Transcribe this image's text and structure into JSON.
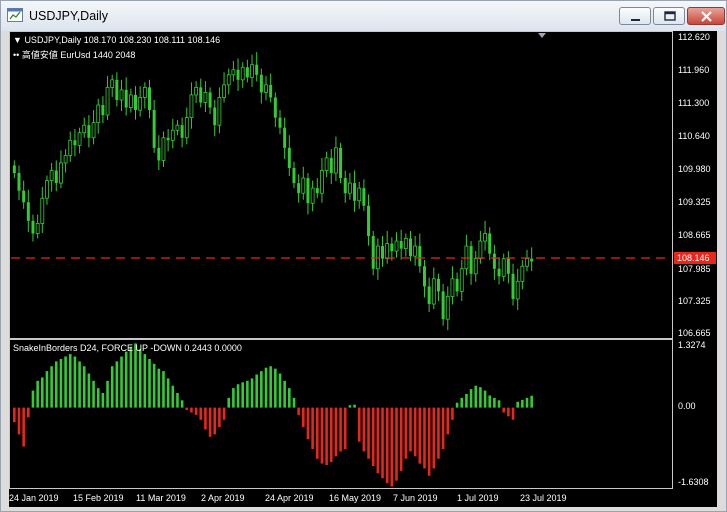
{
  "window": {
    "title": "USDJPY,Daily",
    "buttons": [
      "minimize",
      "maximize",
      "close"
    ]
  },
  "main_chart": {
    "header_line": "USDJPY,Daily  108.170 108.230 108.111 108.146",
    "subheader_line": "高値安値 EurUsd 1440 2048",
    "current_price_label": "108.146",
    "price_axis_labels": [
      "112.620",
      "111.960",
      "111.300",
      "110.640",
      "109.980",
      "109.325",
      "108.665",
      "107.985",
      "107.325",
      "106.665"
    ],
    "colors": {
      "background": "#000000",
      "candles": "#32cd32",
      "price_line": "#e8261c"
    }
  },
  "indicator": {
    "header_line": "SnakeInBorders D24, FORCE UP -DOWN  0.2443 0.0000",
    "axis_labels": [
      "1.3274",
      "0.00",
      "-1.6308"
    ],
    "colors": {
      "positive": "#32cd32",
      "negative": "#e8261c"
    }
  },
  "date_axis": [
    "24 Jan 2019",
    "15 Feb 2019",
    "11 Mar 2019",
    "2 Apr 2019",
    "24 Apr 2019",
    "16 May 2019",
    "7 Jun 2019",
    "1 Jul 2019",
    "23 Jul 2019"
  ],
  "chart_data": {
    "type": "candlestick",
    "symbol": "USDJPY",
    "timeframe": "Daily",
    "last_bar": {
      "open": 108.17,
      "high": 108.23,
      "low": 108.111,
      "close": 108.146
    },
    "y_range": [
      106.665,
      112.62
    ],
    "closes": [
      109.9,
      109.55,
      109.32,
      108.95,
      108.7,
      108.9,
      109.4,
      109.75,
      109.95,
      109.7,
      110.1,
      110.25,
      110.55,
      110.45,
      110.7,
      110.85,
      110.6,
      110.9,
      111.25,
      111.05,
      111.6,
      111.75,
      111.35,
      111.55,
      111.2,
      111.45,
      111.15,
      111.4,
      111.6,
      111.15,
      110.4,
      110.15,
      110.6,
      110.55,
      110.75,
      110.85,
      110.6,
      111.0,
      111.45,
      111.6,
      111.3,
      111.5,
      111.2,
      110.85,
      111.4,
      111.65,
      111.85,
      111.95,
      111.75,
      112.0,
      111.8,
      112.05,
      111.85,
      111.5,
      111.65,
      111.4,
      111.0,
      110.8,
      110.4,
      110.0,
      109.7,
      109.5,
      109.8,
      109.3,
      109.6,
      109.5,
      109.95,
      110.2,
      109.9,
      110.4,
      109.8,
      109.5,
      109.7,
      109.35,
      109.6,
      109.25,
      108.65,
      108.0,
      108.45,
      108.2,
      108.5,
      108.35,
      108.55,
      108.4,
      108.6,
      108.25,
      108.45,
      108.05,
      107.65,
      107.3,
      107.8,
      107.55,
      107.0,
      107.45,
      107.8,
      107.55,
      108.0,
      108.45,
      107.9,
      108.2,
      108.55,
      108.7,
      108.3,
      108.0,
      107.85,
      108.2,
      107.9,
      107.4,
      107.75,
      108.05,
      108.2,
      108.146
    ],
    "indicator": {
      "name": "SnakeInBorders D24, FORCE UP -DOWN",
      "y_range": [
        -1.6308,
        1.3274
      ],
      "values": [
        -0.3,
        -0.55,
        -0.8,
        -0.2,
        0.35,
        0.55,
        0.62,
        0.75,
        0.85,
        0.95,
        1.0,
        1.05,
        1.1,
        1.05,
        0.95,
        0.85,
        0.7,
        0.55,
        0.4,
        0.3,
        0.55,
        0.85,
        0.95,
        1.05,
        1.15,
        1.25,
        1.32,
        1.2,
        1.1,
        1.0,
        0.9,
        0.8,
        0.75,
        0.6,
        0.45,
        0.3,
        0.15,
        -0.05,
        -0.1,
        -0.15,
        -0.25,
        -0.45,
        -0.6,
        -0.55,
        -0.4,
        -0.25,
        0.2,
        0.4,
        0.48,
        0.52,
        0.55,
        0.6,
        0.68,
        0.75,
        0.82,
        0.85,
        0.8,
        0.7,
        0.55,
        0.4,
        0.2,
        -0.15,
        -0.4,
        -0.65,
        -0.85,
        -1.05,
        -1.15,
        -1.18,
        -1.12,
        -1.0,
        -0.9,
        -0.85,
        0.05,
        0.06,
        -0.7,
        -0.9,
        -1.05,
        -1.2,
        -1.35,
        -1.45,
        -1.55,
        -1.62,
        -1.5,
        -1.3,
        -1.05,
        -0.9,
        -1.0,
        -1.15,
        -1.25,
        -1.4,
        -1.25,
        -1.05,
        -0.85,
        -0.55,
        -0.25,
        0.1,
        0.2,
        0.28,
        0.38,
        0.45,
        0.42,
        0.35,
        0.25,
        0.2,
        0.15,
        -0.1,
        -0.18,
        -0.25,
        0.12,
        0.16,
        0.2,
        0.2443
      ]
    }
  }
}
